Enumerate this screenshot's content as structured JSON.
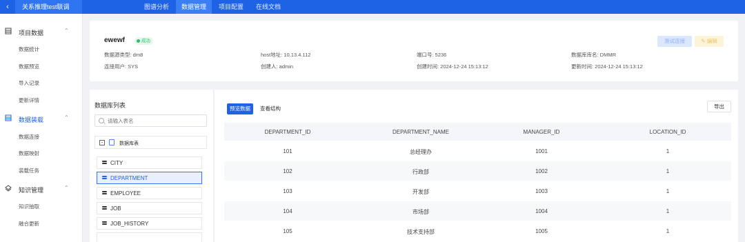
{
  "topbar": {
    "back_icon": "chevron-left-icon",
    "project_name": "关系推理test联调",
    "nav": [
      "图谱分析",
      "数据管理",
      "项目配置",
      "在线文档"
    ],
    "active_nav": "数据管理",
    "colors": {
      "bar": "#1e62e6",
      "active": "#3b7ff5"
    }
  },
  "sidebar": {
    "groups": [
      {
        "icon": "database-icon",
        "title": "项目数据",
        "items": [
          "数据统计",
          "数据预览",
          "导入记录",
          "更新详情"
        ]
      },
      {
        "icon": "database-icon",
        "title": "数据装载",
        "items": [
          "数据连接",
          "数据映射",
          "装载任务"
        ]
      },
      {
        "icon": "layers-icon",
        "title": "知识管理",
        "items": [
          "知识抽取",
          "融合更新"
        ]
      }
    ]
  },
  "datasource": {
    "name": "ewewf",
    "status": "成功",
    "type": "数据源类型: dm8",
    "user": "连接用户: SYS",
    "host": "host地址: 10.13.4.112",
    "creator": "创建人: admin",
    "port": "端口号: 5236",
    "created": "创建时间: 2024-12-24 15:13:12",
    "dbname": "数据库库名: DMMR",
    "updated": "更新时间: 2024-12-24 15:13:12",
    "test_button": "测试连接",
    "edit_button": "编辑"
  },
  "dblist": {
    "title": "数据库列表",
    "search_placeholder": "请输入表名",
    "root_label": "数据库表",
    "tables": [
      "CITY",
      "DEPARTMENT",
      "EMPLOYEE",
      "JOB",
      "JOB_HISTORY"
    ],
    "selected": "DEPARTMENT"
  },
  "datapanel": {
    "tabs": [
      "预览数据",
      "查看结构"
    ],
    "active_tab": "预览数据",
    "export_button": "导出",
    "columns": [
      "DEPARTMENT_ID",
      "DEPARTMENT_NAME",
      "MANAGER_ID",
      "LOCATION_ID"
    ],
    "rows": [
      [
        "101",
        "总经理办",
        "1001",
        "1"
      ],
      [
        "102",
        "行政部",
        "1002",
        "1"
      ],
      [
        "103",
        "开发部",
        "1003",
        "1"
      ],
      [
        "104",
        "市场部",
        "1004",
        "1"
      ],
      [
        "105",
        "技术支持部",
        "1005",
        "1"
      ]
    ]
  }
}
